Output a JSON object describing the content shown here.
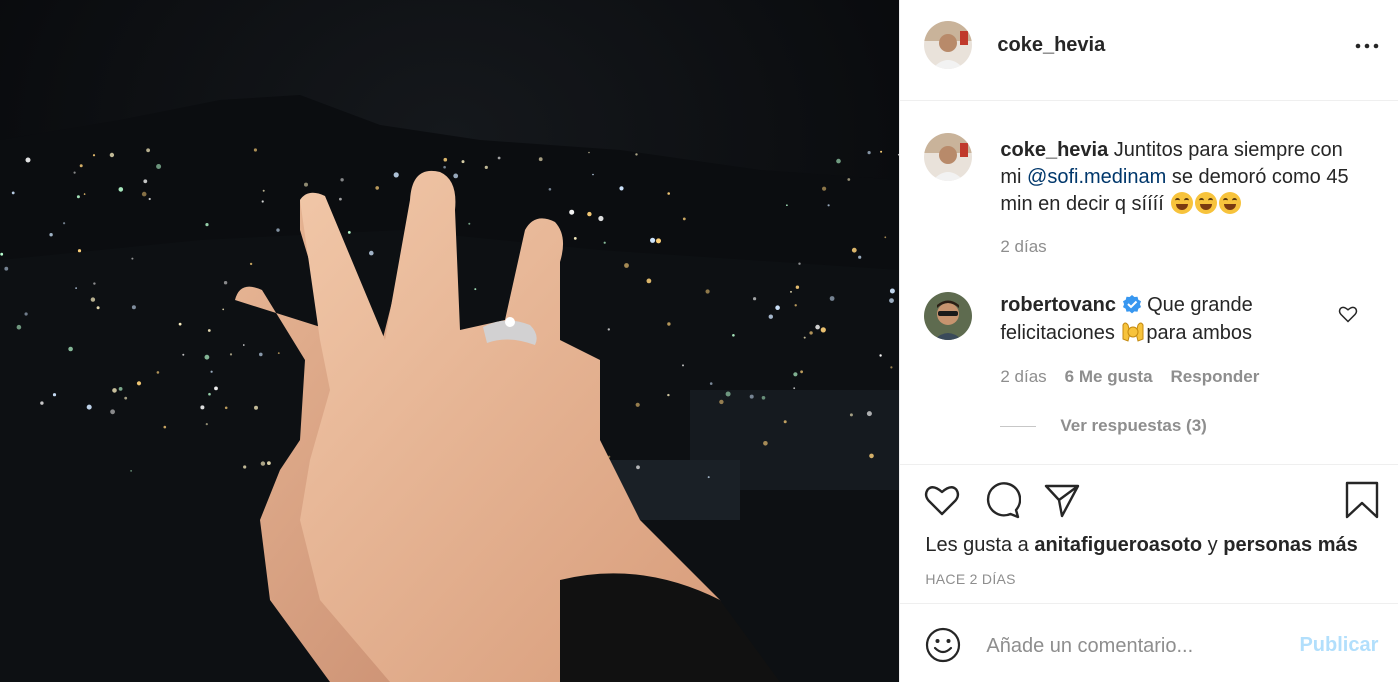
{
  "post": {
    "image_alt": "Dos manos entrelazadas con anillo frente a ciudad de noche",
    "author": "coke_hevia",
    "more_icon": "more-horizontal-icon"
  },
  "caption": {
    "user": "coke_hevia",
    "text_before": " Juntitos para siempre con mi ",
    "mention": "@sofi.medinam",
    "text_after": " se demoró como 45 min en decir q síííí ",
    "emoji": [
      "grinning-squinting-face",
      "grinning-squinting-face",
      "grinning-squinting-face"
    ],
    "time": "2 días"
  },
  "comment": {
    "user": "robertovanc",
    "verified": true,
    "text_a": " Que grande felicitaciones ",
    "emoji": "raising-hands",
    "text_b": "para ambos",
    "time": "2 días",
    "likes": "6 Me gusta",
    "reply": "Responder",
    "view_replies": "Ver respuestas (3)"
  },
  "actions": {
    "likes_prefix": "Les gusta a ",
    "likes_user": "anitafigueroasoto",
    "likes_mid": " y ",
    "likes_suffix": "personas más",
    "age": "HACE 2 DÍAS",
    "icons": [
      "heart-icon",
      "comment-icon",
      "share-icon",
      "bookmark-icon"
    ]
  },
  "composer": {
    "placeholder": "Añade un comentario...",
    "publish": "Publicar",
    "publish_color": "#b2dffc"
  }
}
